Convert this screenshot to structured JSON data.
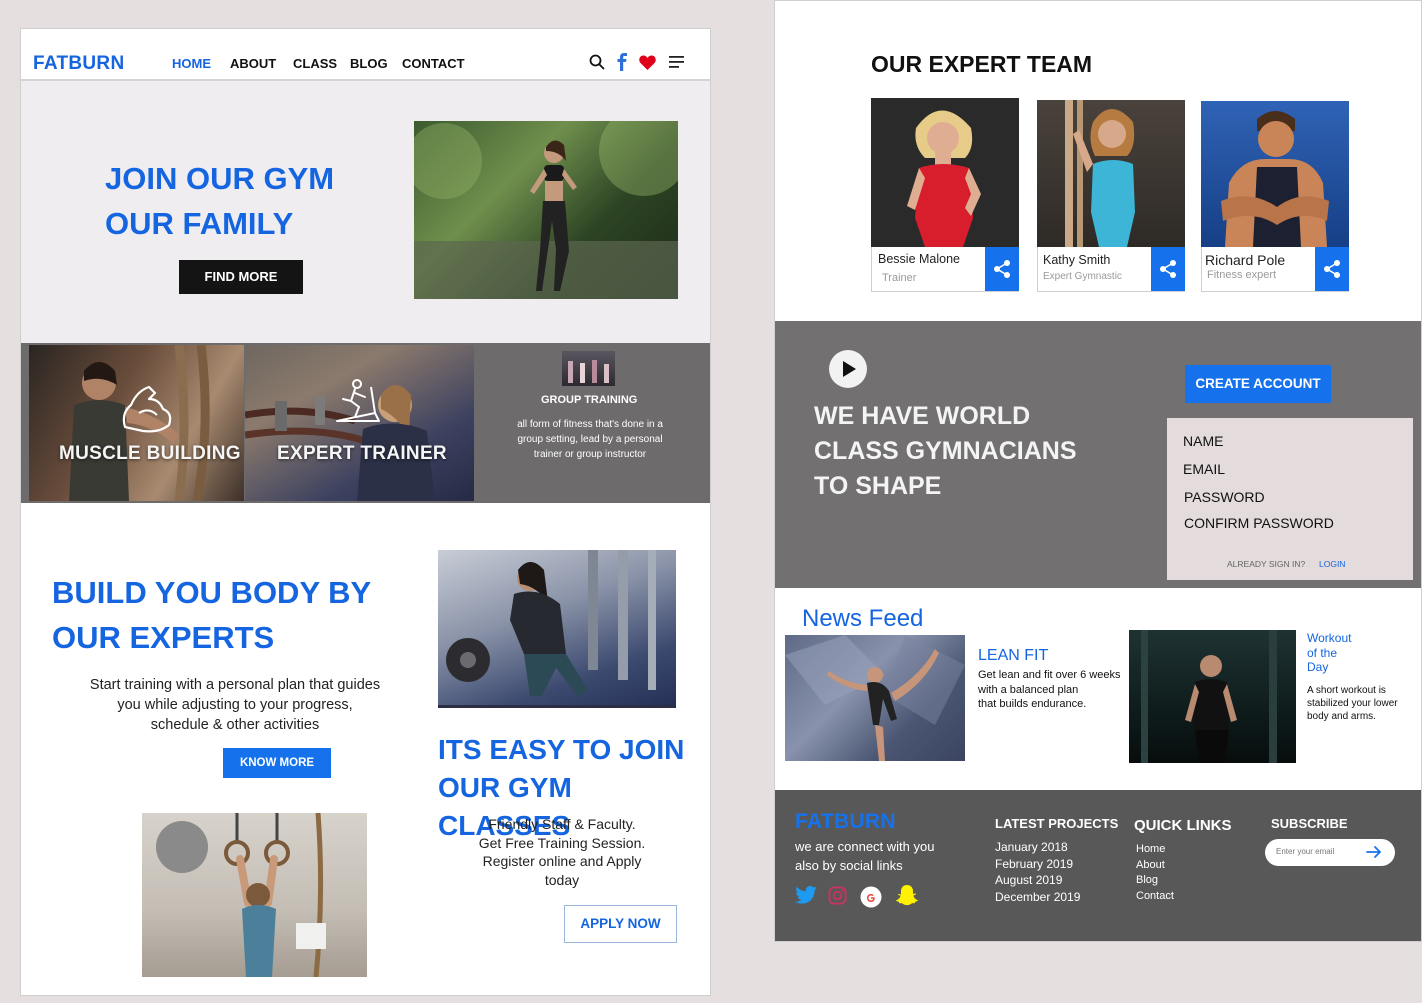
{
  "left_page": {
    "nav": {
      "logo": "FATBURN",
      "items": [
        "HOME",
        "ABOUT",
        "CLASS",
        "BLOG",
        "CONTACT"
      ],
      "active_index": 0
    },
    "hero": {
      "heading_line1": "JOIN OUR GYM",
      "heading_line2": "OUR FAMILY",
      "button": "FIND MORE"
    },
    "tiles": {
      "muscle": "MUSCLE BUILDING",
      "trainer": "EXPERT TRAINER",
      "group_title": "GROUP TRAINING",
      "group_desc_lines": [
        "all form of fitness that's done in a",
        "group setting, lead by a personal",
        "trainer or group instructor"
      ]
    },
    "build": {
      "heading_line1": "BUILD YOU BODY BY",
      "heading_line2": "OUR EXPERTS",
      "desc_lines": [
        "Start training with a personal plan that guides",
        "you while adjusting to your progress,",
        "schedule & other activities"
      ],
      "button": "KNOW MORE"
    },
    "join": {
      "heading_line1": "ITS EASY TO JOIN",
      "heading_line2": "OUR GYM CLASSES",
      "desc_lines": [
        "Friendly Staff & Faculty.",
        "Get Free Training Session.",
        "Register online and Apply",
        "today"
      ],
      "button": "APPLY NOW"
    }
  },
  "right_page": {
    "team": {
      "title": "OUR EXPERT TEAM",
      "members": [
        {
          "name": "Bessie Malone",
          "role": "Trainer"
        },
        {
          "name": "Kathy Smith",
          "role": "Expert Gymnastic"
        },
        {
          "name": "Richard Pole",
          "role": "Fitness expert"
        }
      ]
    },
    "promo": {
      "heading_lines": [
        "WE HAVE WORLD",
        "CLASS GYMNACIANS",
        "TO SHAPE"
      ],
      "create_account": "CREATE ACCOUNT",
      "fields": [
        "NAME",
        "EMAIL",
        "PASSWORD",
        "CONFIRM PASSWORD"
      ],
      "already": "ALREADY SIGN IN?",
      "login": "LOGIN"
    },
    "news": {
      "title": "News Feed",
      "item1_title": "LEAN FIT",
      "item1_lines": [
        "Get lean and fit over 6 weeks",
        "with a balanced plan",
        "that builds endurance."
      ],
      "item2_title_lines": [
        "Workout",
        "of the",
        "Day"
      ],
      "item2_lines": [
        "A short workout is",
        "stabilized your lower",
        "body and arms."
      ]
    },
    "footer": {
      "logo": "FATBURN",
      "tagline_lines": [
        "we are connect with you",
        "also by social links"
      ],
      "projects_title": "LATEST PROJECTS",
      "projects": [
        "January 2018",
        "February 2019",
        "August 2019",
        "December 2019"
      ],
      "links_title": "QUICK LINKS",
      "links": [
        "Home",
        "About",
        "Blog",
        "Contact"
      ],
      "subscribe_title": "SUBSCRIBE",
      "email_placeholder": "Enter your email"
    }
  },
  "colors": {
    "brand_blue": "#1565e0",
    "button_blue": "#1672ec",
    "dark_button": "#141414",
    "gray_section": "#727070",
    "footer_bg": "#595858"
  },
  "icons": [
    "search-icon",
    "facebook-icon",
    "heart-icon",
    "menu-icon",
    "muscle-arm-icon",
    "treadmill-icon",
    "share-icon",
    "play-icon",
    "arrow-right-icon",
    "twitter-icon",
    "instagram-icon",
    "google-icon",
    "snapchat-icon"
  ]
}
